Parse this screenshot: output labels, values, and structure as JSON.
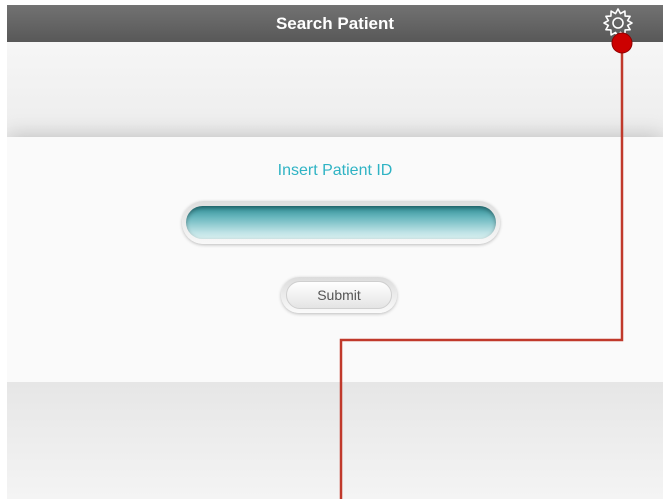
{
  "header": {
    "title": "Search Patient",
    "settings_icon": "gear-icon"
  },
  "form": {
    "label": "Insert Patient ID",
    "patient_id_value": "",
    "submit_label": "Submit"
  },
  "colors": {
    "header_bg": "#616161",
    "label_text": "#2fb3c4",
    "input_fill": "#5fb3ba",
    "annotation_line": "#c0392b"
  }
}
